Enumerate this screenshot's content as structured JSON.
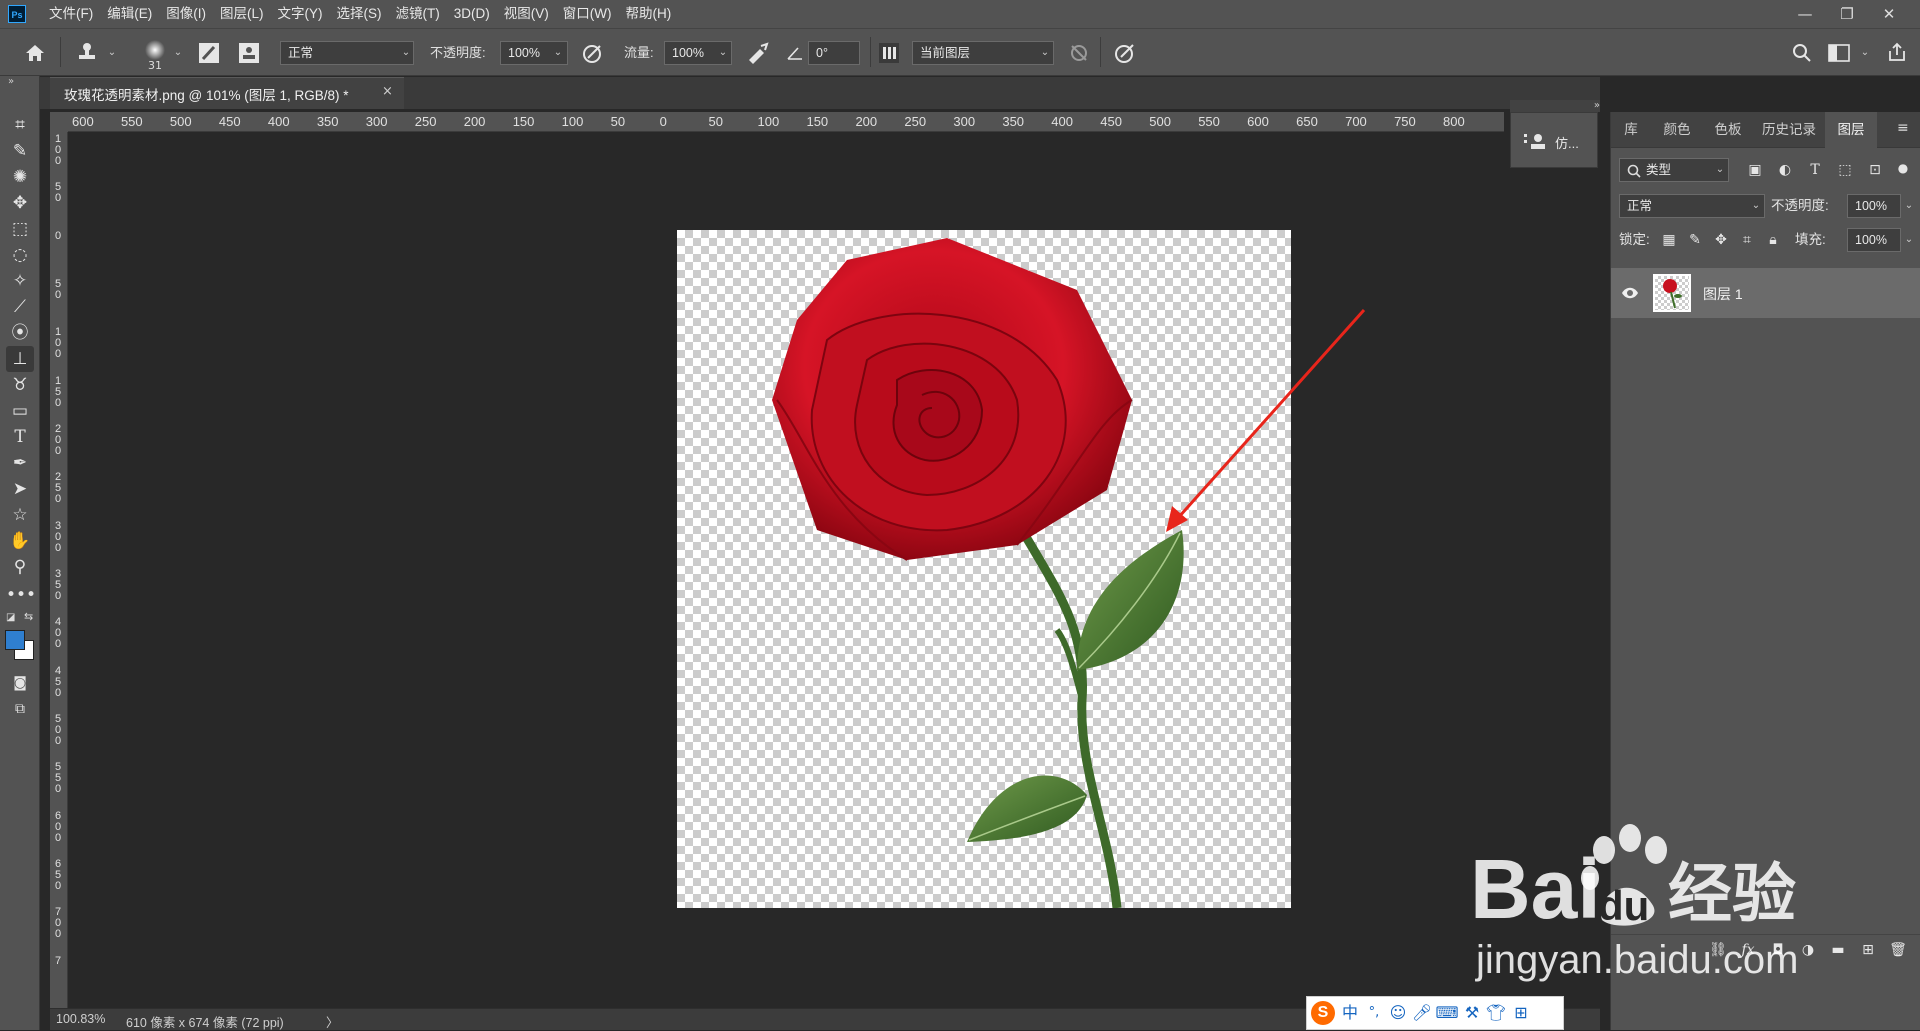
{
  "app": {
    "logo": "Ps"
  },
  "menu": [
    "文件(F)",
    "编辑(E)",
    "图像(I)",
    "图层(L)",
    "文字(Y)",
    "选择(S)",
    "滤镜(T)",
    "3D(D)",
    "视图(V)",
    "窗口(W)",
    "帮助(H)"
  ],
  "window_buttons": {
    "minimize": "—",
    "restore": "❐",
    "close": "✕"
  },
  "options": {
    "brush_size": "31",
    "mode": "正常",
    "opacity_label": "不透明度:",
    "opacity": "100%",
    "flow_label": "流量:",
    "flow": "100%",
    "angle": "0°",
    "sample": "当前图层"
  },
  "document": {
    "tab_title": "玫瑰花透明素材.png @ 101% (图层 1, RGB/8) *",
    "close": "×"
  },
  "ruler": {
    "horizontal": [
      "600",
      "550",
      "500",
      "450",
      "400",
      "350",
      "300",
      "250",
      "200",
      "150",
      "100",
      "50",
      "0",
      "50",
      "100",
      "150",
      "200",
      "250",
      "300",
      "350",
      "400",
      "450",
      "500",
      "550",
      "600",
      "650",
      "700",
      "750",
      "800"
    ],
    "vertical": [
      "1\n0\n0",
      "5\n0",
      "0",
      "5\n0",
      "1\n0\n0",
      "1\n5\n0",
      "2\n0\n0",
      "2\n5\n0",
      "3\n0\n0",
      "3\n5\n0",
      "4\n0\n0",
      "4\n5\n0",
      "5\n0\n0",
      "5\n5\n0",
      "6\n0\n0",
      "6\n5\n0",
      "7\n0\n0",
      "7"
    ]
  },
  "status": {
    "zoom": "100.83%",
    "info": "610 像素 x 674 像素 (72 ppi)",
    "arrow": "〉"
  },
  "mini_panel": {
    "label": "仿..."
  },
  "panel_tabs": [
    "库",
    "颜色",
    "色板",
    "历史记录",
    "图层"
  ],
  "layers": {
    "filter": "类型",
    "blend": "正常",
    "opacity_label": "不透明度:",
    "opacity": "100%",
    "lock_label": "锁定:",
    "fill_label": "填充:",
    "fill": "100%",
    "items": [
      {
        "name": "图层 1",
        "visible": true
      }
    ]
  },
  "watermark": {
    "brand": "Bai",
    "brand2": "du",
    "brand_cn": "经验",
    "url": "jingyan.baidu.com"
  },
  "ime": {
    "lang": "中",
    "punct": "°,"
  },
  "colors": {
    "foreground": "#2f7fd0",
    "background": "#ffffff",
    "arrow": "#e8251b",
    "rose": "#c8101e",
    "leaf": "#3f6e2a"
  }
}
